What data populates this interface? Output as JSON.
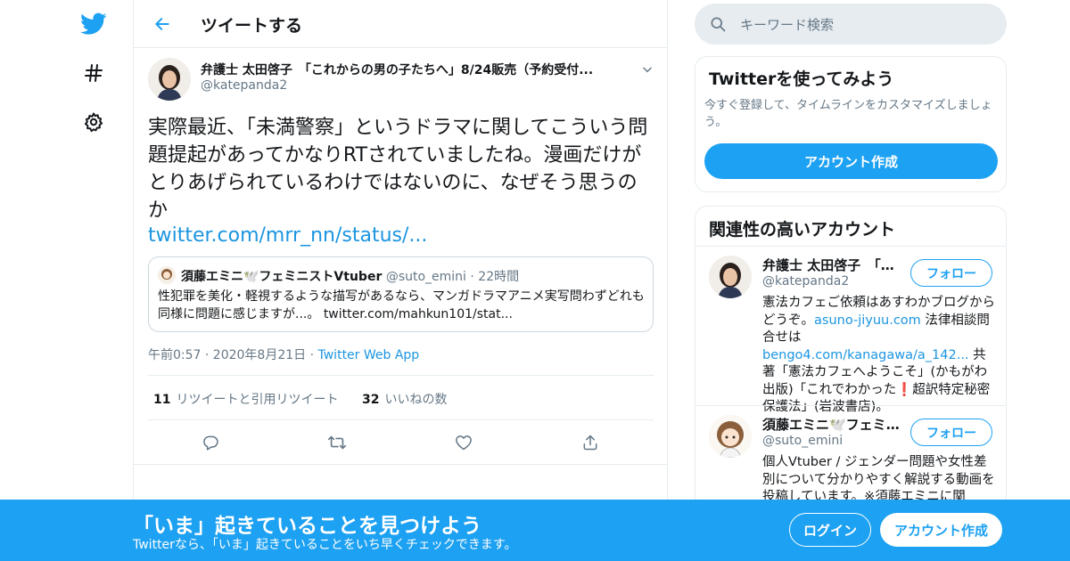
{
  "header": {
    "title": "ツイートする"
  },
  "tweet": {
    "author_name": "弁護士 太田啓子　「これからの男の子たちへ」8/24販売（予約受付...",
    "author_handle": "@katepanda2",
    "text": "実際最近、「未満警察」というドラマに関してこういう問題提起があってかなりRTされていましたね。漫画だけがとりあげられているわけではないのに、なぜそう思うのか",
    "link": "twitter.com/mrr_nn/status/...",
    "quote": {
      "name": "須藤エミニ🕊️フェミニストVtuber",
      "handle": "@suto_emini",
      "dot": "·",
      "time": "22時間",
      "body": "性犯罪を美化・軽視するような描写があるなら、マンガドラマアニメ実写問わずどれも同様に問題に感じますが...。",
      "link": "twitter.com/mahkun101/stat..."
    },
    "timestamp": "午前0:57 · 2020年8月21日",
    "dot": "·",
    "source": "Twitter Web App",
    "retweets": {
      "count": "11",
      "label": "リツイートと引用リツイート"
    },
    "likes": {
      "count": "32",
      "label": "いいねの数"
    }
  },
  "search": {
    "placeholder": "キーワード検索"
  },
  "signup_card": {
    "title": "Twitterを使ってみよう",
    "desc": "今すぐ登録して、タイムラインをカスタマイズしましょう。",
    "button": "アカウント作成"
  },
  "related": {
    "title": "関連性の高いアカウント",
    "accounts": [
      {
        "name": "弁護士 太田啓子　「これからの男の子たちへ」",
        "handle": "@katepanda2",
        "follow": "フォロー",
        "bio_1": "憲法カフェご依頼はあすわかブログからどうぞ。",
        "bio_link_1": "asuno-jiyuu.com",
        "bio_2": " 法律相談問合せは",
        "bio_link_2": "bengo4.com/kanagawa/a_142...",
        "bio_3": " 共著「憲法カフェへようこそ」(かもがわ出版)「これでわかった❗️超訳特定秘密保護法」(岩波書店)。"
      },
      {
        "name": "須藤エミニ🕊️フェミニストVtuber",
        "handle": "@suto_emini",
        "follow": "フォロー",
        "bio": "個人Vtuber / ジェンダー問題や女性差別について分かりやすく解説する動画を投稿しています。※須藤エミニに関"
      }
    ]
  },
  "banner": {
    "title": "「いま」起きていることを見つけよう",
    "subtitle": "Twitterなら、「いま」起きていることをいち早くチェックできます。",
    "login": "ログイン",
    "signup": "アカウント作成"
  },
  "colors": {
    "accent": "#1da1f2",
    "link": "#1b95e0",
    "muted": "#657786",
    "border": "#e6ecf0"
  }
}
